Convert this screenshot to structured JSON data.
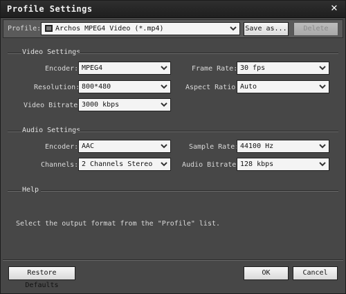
{
  "window": {
    "title": "Profile Settings"
  },
  "profile": {
    "label": "Profile:",
    "value": "Archos MPEG4 Video (*.mp4)",
    "save_as_label": "Save as...",
    "delete_label": "Delete"
  },
  "video": {
    "title": "Video Settings",
    "encoder_label": "Encoder:",
    "encoder_value": "MPEG4",
    "frame_rate_label": "Frame Rate:",
    "frame_rate_value": "30 fps",
    "resolution_label": "Resolution:",
    "resolution_value": "800*480",
    "aspect_ratio_label": "Aspect Ratio:",
    "aspect_ratio_value": "Auto",
    "bitrate_label": "Video Bitrate:",
    "bitrate_value": "3000 kbps"
  },
  "audio": {
    "title": "Audio Settings",
    "encoder_label": "Encoder:",
    "encoder_value": "AAC",
    "sample_rate_label": "Sample Rate:",
    "sample_rate_value": "44100 Hz",
    "channels_label": "Channels:",
    "channels_value": "2 Channels Stereo",
    "bitrate_label": "Audio Bitrate:",
    "bitrate_value": "128 kbps"
  },
  "help": {
    "title": "Help",
    "text": "Select the output format from the \"Profile\" list."
  },
  "footer": {
    "restore_label": "Restore Defaults",
    "ok_label": "OK",
    "cancel_label": "Cancel"
  }
}
